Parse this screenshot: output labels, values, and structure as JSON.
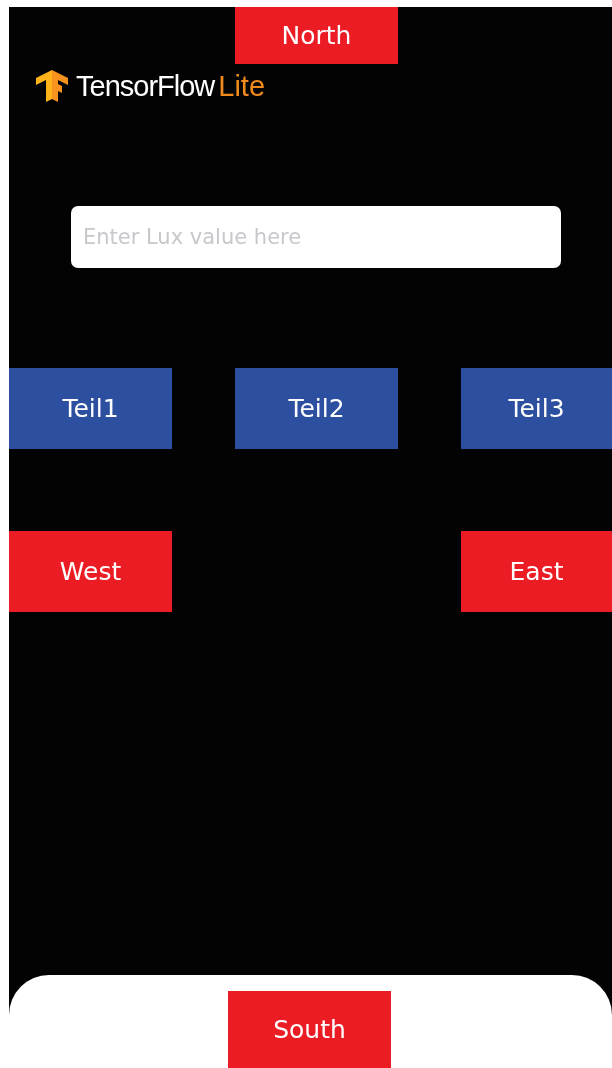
{
  "logo": {
    "name": "TensorFlow",
    "suffix": "Lite"
  },
  "top_button": {
    "label": "North"
  },
  "lux_field": {
    "placeholder": "Enter Lux value here"
  },
  "part_buttons": [
    {
      "label": "Teil1"
    },
    {
      "label": "Teil2"
    },
    {
      "label": "Teil3"
    }
  ],
  "side_buttons": [
    {
      "label": "West"
    },
    {
      "label": "East"
    }
  ],
  "bottom_button": {
    "label": "South"
  }
}
